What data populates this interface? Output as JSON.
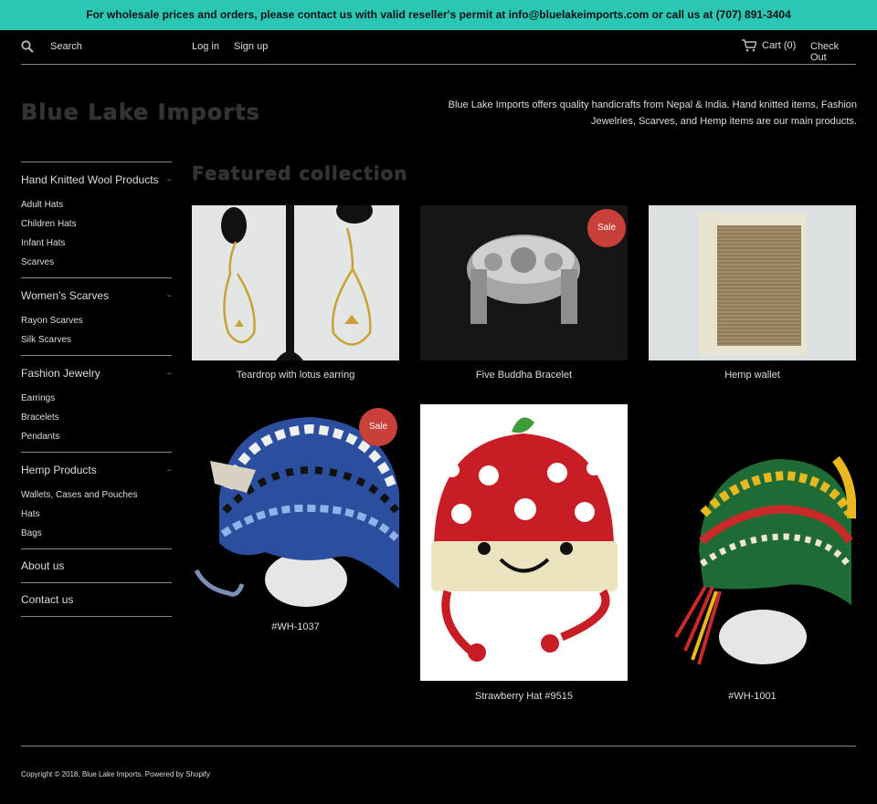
{
  "banner": "For wholesale prices and orders, please contact us with valid reseller's permit at info@bluelakeimports.com or call us at (707) 891-3404",
  "header": {
    "search_placeholder": "Search",
    "login": "Log in",
    "signup": "Sign up",
    "cart": "Cart (0)",
    "checkout": "Check Out"
  },
  "brand": {
    "logo": "Blue Lake Imports",
    "tagline": "Blue Lake Imports offers quality handicrafts from Nepal & India. Hand knitted items, Fashion Jewelries, Scarves, and Hemp items are our main products."
  },
  "sidebar": {
    "groups": [
      {
        "label": "Hand Knitted Wool Products",
        "items": [
          "Adult Hats",
          "Children Hats",
          "Infant Hats",
          "Scarves"
        ]
      },
      {
        "label": "Women's Scarves",
        "items": [
          "Rayon Scarves",
          "Silk Scarves"
        ]
      },
      {
        "label": "Fashion Jewelry",
        "items": [
          "Earrings",
          "Bracelets",
          "Pendants"
        ]
      },
      {
        "label": "Hemp Products",
        "items": [
          "Wallets, Cases and Pouches",
          "Hats",
          "Bags"
        ]
      }
    ],
    "links": [
      "About us",
      "Contact us"
    ]
  },
  "featured": {
    "heading": "Featured collection",
    "products": [
      {
        "title": "Teardrop with lotus earring",
        "badge": ""
      },
      {
        "title": "Five Buddha Bracelet",
        "badge": "Sale"
      },
      {
        "title": "Hemp wallet",
        "badge": ""
      },
      {
        "title": "#WH-1037",
        "badge": "Sale"
      },
      {
        "title": "Strawberry Hat #9515",
        "badge": ""
      },
      {
        "title": "#WH-1001",
        "badge": ""
      }
    ]
  },
  "footer": "Copyright © 2018, Blue Lake Imports. Powered by Shopify",
  "colors": {
    "banner": "#2ac7b5",
    "sale": "#c9403a",
    "background": "#000000"
  }
}
